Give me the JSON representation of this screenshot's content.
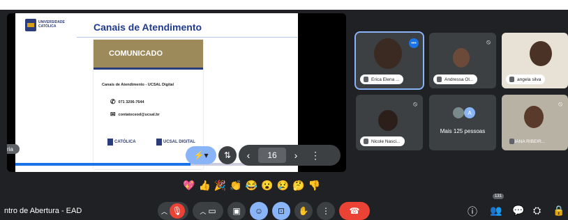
{
  "slide": {
    "logo_text": "UNIVERSIDADE CATÓLICA",
    "title": "Canais de Atendimento",
    "panel_header": "COMUNICADO",
    "subtitle": "Canais de Atendimento - UCSAL Digital",
    "phone": "071 3206-7644",
    "email": "contatoceod@ucsal.br",
    "footer_logo_1": "CATÓLICA",
    "footer_logo_2": "UCSAL DIGITAL"
  },
  "presentation_controls": {
    "page_number": "16",
    "prev_icon": "chevron-left-icon",
    "next_icon": "chevron-right-icon",
    "more_icon": "more-vert-icon",
    "laser_icon": "laser-pointer-icon",
    "side_label": "ria"
  },
  "participants": [
    {
      "name": "Erica Elena ...",
      "speaking": true
    },
    {
      "name": "Andressa Ol...",
      "speaking": false
    },
    {
      "name": "angela silva",
      "speaking": false
    },
    {
      "name": "Nicole Nasci...",
      "speaking": false
    },
    {
      "name": "Mais 125 pessoas",
      "speaking": false
    },
    {
      "name": "LUANA RIBEIR...",
      "speaking": false
    }
  ],
  "more_avatar_letter": "A",
  "reactions": [
    "💖",
    "👍",
    "🎉",
    "👏",
    "😂",
    "😮",
    "😢",
    "🤔",
    "👎"
  ],
  "meeting_title": "ntro de Abertura - EAD",
  "controls": {
    "mic": "mic-off-icon",
    "camera": "camera-icon",
    "captions": "captions-icon",
    "emoji": "emoji-icon",
    "present": "present-icon",
    "hand": "raise-hand-icon",
    "more": "more-vert-icon",
    "leave": "end-call-icon"
  },
  "people_count": "131",
  "colors": {
    "bg": "#202124",
    "accent": "#8ab4f8",
    "leave": "#ea4335",
    "comunicado": "#9c8a5a",
    "title_blue": "#1f3a93"
  }
}
